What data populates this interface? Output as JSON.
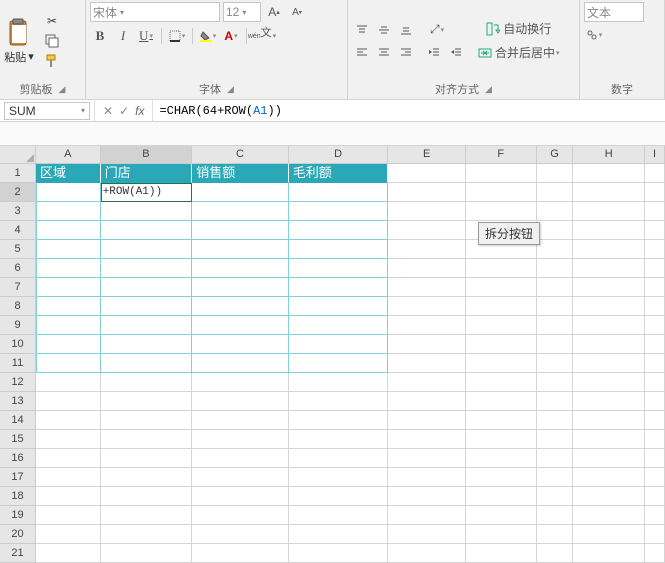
{
  "ribbon": {
    "clipboard": {
      "paste_label": "粘贴",
      "group_label": "剪贴板"
    },
    "font": {
      "name": "宋体",
      "size": "12",
      "bold": "B",
      "italic": "I",
      "underline": "U",
      "group_label": "字体"
    },
    "alignment": {
      "wrap": "自动换行",
      "merge": "合并后居中",
      "group_label": "对齐方式"
    },
    "number": {
      "format": "文本",
      "group_label": "数字"
    }
  },
  "namebox": "SUM",
  "formula_prefix": "=CHAR(64+ROW(",
  "formula_ref": "A1",
  "formula_suffix": "))",
  "columns": [
    "A",
    "B",
    "C",
    "D",
    "E",
    "F",
    "G",
    "H",
    "I"
  ],
  "rows": [
    "1",
    "2",
    "3",
    "4",
    "5",
    "6",
    "7",
    "8",
    "9",
    "10",
    "11",
    "12",
    "13",
    "14",
    "15",
    "16",
    "17",
    "18",
    "19",
    "20",
    "21"
  ],
  "table_headers": [
    "区域",
    "门店",
    "销售额",
    "毛利额"
  ],
  "active_cell_text": "+ROW(A1))",
  "float_button": "拆分按钮"
}
